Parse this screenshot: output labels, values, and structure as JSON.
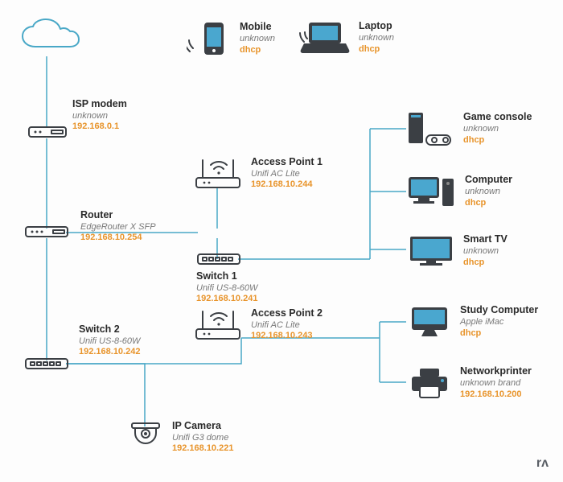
{
  "nodes": {
    "mobile": {
      "name": "Mobile",
      "model": "unknown",
      "addr": "dhcp"
    },
    "laptop": {
      "name": "Laptop",
      "model": "unknown",
      "addr": "dhcp"
    },
    "isp_modem": {
      "name": "ISP modem",
      "model": "unknown",
      "addr": "192.168.0.1"
    },
    "router": {
      "name": "Router",
      "model": "EdgeRouter X SFP",
      "addr": "192.168.10.254"
    },
    "ap1": {
      "name": "Access Point 1",
      "model": "Unifi AC Lite",
      "addr": "192.168.10.244"
    },
    "switch1": {
      "name": "Switch 1",
      "model": "Unifi US-8-60W",
      "addr": "192.168.10.241"
    },
    "switch2": {
      "name": "Switch 2",
      "model": "Unifi US-8-60W",
      "addr": "192.168.10.242"
    },
    "ap2": {
      "name": "Access Point 2",
      "model": "Unifi AC Lite",
      "addr": "192.168.10.243"
    },
    "ip_camera": {
      "name": "IP Camera",
      "model": "Unifi G3 dome",
      "addr": "192.168.10.221"
    },
    "game_console": {
      "name": "Game console",
      "model": "unknown",
      "addr": "dhcp"
    },
    "computer": {
      "name": "Computer",
      "model": "unknown",
      "addr": "dhcp"
    },
    "smart_tv": {
      "name": "Smart TV",
      "model": "unknown",
      "addr": "dhcp"
    },
    "study_computer": {
      "name": "Study Computer",
      "model": "Apple iMac",
      "addr": "dhcp"
    },
    "network_printer": {
      "name": "Networkprinter",
      "model": "unknown brand",
      "addr": "192.168.10.200"
    }
  },
  "topology": {
    "cloud": [
      "isp_modem"
    ],
    "isp_modem": [
      "router"
    ],
    "router": [
      "switch1",
      "switch2"
    ],
    "switch1": [
      "ap1",
      "game_console",
      "computer",
      "smart_tv"
    ],
    "switch2": [
      "ap2",
      "ip_camera"
    ],
    "ap1": [
      "mobile",
      "laptop"
    ],
    "ap2": [
      "study_computer",
      "network_printer"
    ]
  },
  "watermark": "rʌ",
  "colors": {
    "line": "#49a8c7",
    "addr": "#e8942b",
    "body": "#3b3f44",
    "screen": "#4aa7cf"
  }
}
